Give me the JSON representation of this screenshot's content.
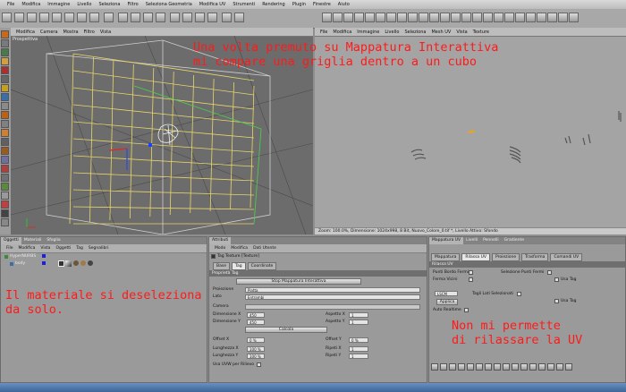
{
  "menubar": {
    "items": [
      "File",
      "Modifica",
      "Immagine",
      "Livello",
      "Seleziona",
      "Filtro",
      "Seleziona Geometria",
      "Modifica UV",
      "Strumenti",
      "Rendering",
      "Plugin",
      "Finestre",
      "Aiuto"
    ]
  },
  "viewport_left": {
    "title": "Prospettiva",
    "menu": [
      "Modifica",
      "Camera",
      "Mostra",
      "Filtro",
      "Vista"
    ]
  },
  "viewport_right": {
    "menu": [
      "File",
      "Modifica",
      "Immagine",
      "Livello",
      "Seleziona",
      "Mesh UV",
      "Vista",
      "Texture"
    ],
    "status": "Zoom: 100.0%, Dimensione: 1024x998, 8 Bit, Nuovo_Colore_0.tif *, Livello Attivo: Sfondo"
  },
  "objects_panel": {
    "tabs": [
      "Oggetti",
      "Materiali",
      "Sfoglia"
    ],
    "menu": [
      "File",
      "Modifica",
      "Vista",
      "Oggetti",
      "Tag",
      "Segnalibri"
    ],
    "items": [
      {
        "name": "HyperNURBS"
      },
      {
        "name": "body"
      }
    ]
  },
  "attributes_panel": {
    "tab": "Attributi",
    "menu": [
      "Modo",
      "Modifica",
      "Dati Utente"
    ],
    "header": "Tag Texture [Texture]",
    "subtabs": [
      "Base",
      "Tag",
      "Coordinate"
    ],
    "section": "Proprietà Tag",
    "stop_button": "Stop Mappatura Interattiva",
    "fields": {
      "proiezione_label": "Proiezione",
      "proiezione_value": "Piatta",
      "lato_label": "Lato",
      "lato_value": "Entrambi",
      "camera_label": "Camera",
      "dim_x_label": "Dimensione X",
      "dim_x_value": "450",
      "dim_y_label": "Dimensione Y",
      "dim_y_value": "450",
      "aspect_x_label": "Aspetto X",
      "aspect_x_value": "1",
      "aspect_y_label": "Aspetto Y",
      "aspect_y_value": "1",
      "calcola": "Calcola",
      "offset_x_label": "Offset X",
      "offset_x_value": "0 %",
      "offset_y_label": "Offset Y",
      "offset_y_value": "0 %",
      "lungh_x_label": "Lunghezza X",
      "lungh_x_value": "100 %",
      "lungh_y_label": "Lunghezza Y",
      "lungh_y_value": "100 %",
      "ripeti_x_label": "Ripeti X",
      "ripeti_x_value": "1",
      "ripeti_y_label": "Ripeti Y",
      "ripeti_y_value": "1",
      "uvw_label": "Usa UVW per Rilievo"
    }
  },
  "uv_panel": {
    "tabs": [
      "Mappatura UV",
      "Livelli",
      "Pennelli",
      "Gradiente"
    ],
    "subtabs": [
      "Mappatura",
      "Rilassa UV",
      "Proiezione",
      "Trasforma",
      "Comandi UV"
    ],
    "section": "Rilassa UV",
    "punti_bordo": "Punti Bordo Fermi",
    "ferma_vicini": "Ferma Vicini",
    "selezione": "Selezione Punti Fermi",
    "usa_tag": "Usa Tag",
    "lscm": "LSCM",
    "applica": "Applica",
    "auto_realtime": "Auto Realtime",
    "tagli_label": "Tagli Lati Selezionati"
  },
  "annotations": {
    "top": "Una volta premuto su Mappatura Interattiva\nmi compare una griglia dentro a un cubo",
    "left": "Il materiale si deseleziona\nda solo.",
    "right": "Non mi permette\ndi rilassare la UV"
  },
  "colors": {
    "annotation": "#ff1a1a",
    "grid": "#e8d66a",
    "accent": "#3d6597"
  }
}
